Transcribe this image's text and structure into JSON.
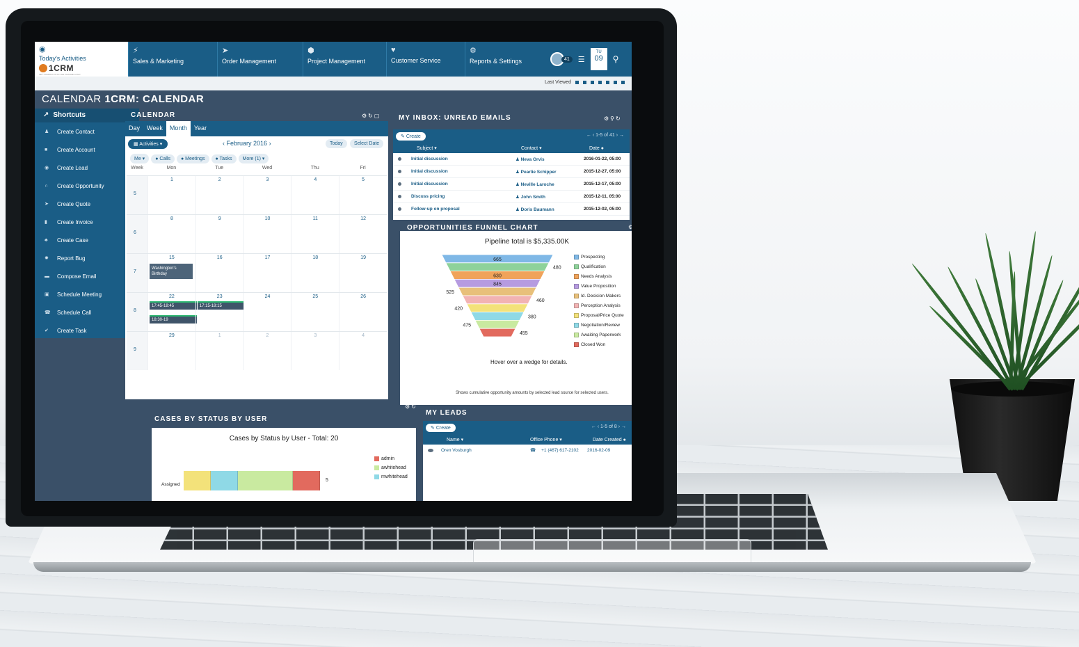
{
  "nav": {
    "home_label": "Today's Activities",
    "brand": "1CRM",
    "brand_tagline": "SET COMPANY INTO THE CHANGE LOGO",
    "items": [
      {
        "label": "Sales & Marketing",
        "icon": "bolt-icon"
      },
      {
        "label": "Order Management",
        "icon": "paper-plane-icon"
      },
      {
        "label": "Project Management",
        "icon": "cube-icon"
      },
      {
        "label": "Customer Service",
        "icon": "heart-icon"
      },
      {
        "label": "Reports & Settings",
        "icon": "gear-icon"
      }
    ],
    "notification_count": "41",
    "date_dow": "TU",
    "date_day": "09",
    "last_viewed_label": "Last Viewed"
  },
  "page_title_prefix": "CALENDAR",
  "page_title_main": "1CRM: CALENDAR",
  "sidebar": {
    "heading": "Shortcuts",
    "items": [
      {
        "label": "Create Contact",
        "icon": "person-icon"
      },
      {
        "label": "Create Account",
        "icon": "building-icon"
      },
      {
        "label": "Create Lead",
        "icon": "lead-icon"
      },
      {
        "label": "Create Opportunity",
        "icon": "magnet-icon"
      },
      {
        "label": "Create Quote",
        "icon": "send-icon"
      },
      {
        "label": "Create Invoice",
        "icon": "invoice-icon"
      },
      {
        "label": "Create Case",
        "icon": "case-icon"
      },
      {
        "label": "Report Bug",
        "icon": "bug-icon"
      },
      {
        "label": "Compose Email",
        "icon": "mail-icon"
      },
      {
        "label": "Schedule Meeting",
        "icon": "meeting-icon"
      },
      {
        "label": "Schedule Call",
        "icon": "phone-icon"
      },
      {
        "label": "Create Task",
        "icon": "task-icon"
      }
    ]
  },
  "calendar": {
    "title": "CALENDAR",
    "tabs": [
      "Day",
      "Week",
      "Month",
      "Year"
    ],
    "active_tab": "Month",
    "activities_label": "Activities",
    "month_label": "February 2016",
    "today_label": "Today",
    "select_date_label": "Select Date",
    "filters": [
      "Me",
      "Calls",
      "Meetings",
      "Tasks",
      "More (1)"
    ],
    "headers": [
      "Week",
      "Mon",
      "Tue",
      "Wed",
      "Thu",
      "Fri"
    ],
    "weeks": [
      {
        "num": "5",
        "days": [
          "1",
          "2",
          "3",
          "4",
          "5"
        ]
      },
      {
        "num": "6",
        "days": [
          "8",
          "9",
          "10",
          "11",
          "12"
        ]
      },
      {
        "num": "7",
        "days": [
          "15",
          "16",
          "17",
          "18",
          "19"
        ]
      },
      {
        "num": "8",
        "days": [
          "22",
          "23",
          "24",
          "25",
          "26"
        ]
      },
      {
        "num": "9",
        "days": [
          "29",
          "1",
          "2",
          "3",
          "4"
        ]
      }
    ],
    "events": {
      "holiday": "Washington's Birthday",
      "mon_22_a": "17:45-18:45",
      "mon_22_b": "18:30-19",
      "tue_23": "17:15-18:15"
    }
  },
  "inbox": {
    "title": "MY INBOX: UNREAD EMAILS",
    "create_label": "Create",
    "pager": "1-5 of 41",
    "columns": [
      "Subject",
      "Contact",
      "Date"
    ],
    "rows": [
      {
        "subject": "Initial discussion",
        "contact": "Neva Orvis",
        "date": "2016-01-22, 05:00"
      },
      {
        "subject": "Initial discussion",
        "contact": "Pearlie Schipper",
        "date": "2015-12-27, 05:00"
      },
      {
        "subject": "Initial discussion",
        "contact": "Neville Laroche",
        "date": "2015-12-17, 05:00"
      },
      {
        "subject": "Discuss pricing",
        "contact": "John Smith",
        "date": "2015-12-11, 05:00"
      },
      {
        "subject": "Follow-up on proposal",
        "contact": "Doris Baumann",
        "date": "2015-12-02, 05:00"
      }
    ]
  },
  "funnel": {
    "panel_title": "OPPORTUNITIES FUNNEL CHART",
    "hover_note": "Hover over a wedge for details.",
    "footer": "Shows cumulative opportunity amounts by selected lead source for selected users."
  },
  "cases": {
    "panel_title": "CASES BY STATUS BY USER"
  },
  "leads": {
    "title": "MY LEADS",
    "create_label": "Create",
    "pager": "1-5 of 8",
    "columns": [
      "Name",
      "Office Phone",
      "Date Created"
    ],
    "rows": [
      {
        "name": "Oren Vosburgh",
        "phone": "+1 (467) 617-2102",
        "date": "2016-02-09"
      }
    ]
  },
  "chart_data": [
    {
      "type": "funnel",
      "title": "Pipeline total is $5,335.00K",
      "series": [
        {
          "name": "Prospecting",
          "value": 665,
          "color": "#7fb8e6"
        },
        {
          "name": "Qualification",
          "value": 480,
          "color": "#8ed29a"
        },
        {
          "name": "Needs Analysis",
          "value": 630,
          "color": "#f0a35a"
        },
        {
          "name": "Value Proposition",
          "value": 845,
          "color": "#b69be0"
        },
        {
          "name": "Id. Decision Makers",
          "value": 525,
          "color": "#e8c07a"
        },
        {
          "name": "Perception Analysis",
          "value": 460,
          "color": "#f2b3b3"
        },
        {
          "name": "Proposal/Price Quote",
          "value": 420,
          "color": "#f3e27a"
        },
        {
          "name": "Negotiation/Review",
          "value": 380,
          "color": "#8fd9e6"
        },
        {
          "name": "Awaiting Paperwork",
          "value": 475,
          "color": "#c9eaa0"
        },
        {
          "name": "Closed Won",
          "value": 455,
          "color": "#e26a5e"
        }
      ]
    },
    {
      "type": "bar",
      "title": "Cases by Status by User - Total: 20",
      "categories": [
        "Assigned"
      ],
      "series": [
        {
          "name": "admin",
          "values": [
            1
          ],
          "color": "#e26a5e"
        },
        {
          "name": "awhitehead",
          "values": [
            2
          ],
          "color": "#c9eaa0"
        },
        {
          "name": "mwhitehead",
          "values": [
            1
          ],
          "color": "#8fd9e6"
        }
      ],
      "segment_colors": [
        "#f3e27a",
        "#8fd9e6",
        "#c9eaa0",
        "#e26a5e"
      ],
      "segment_values": [
        1,
        1,
        2,
        1
      ],
      "visible_total_label": "5"
    }
  ]
}
